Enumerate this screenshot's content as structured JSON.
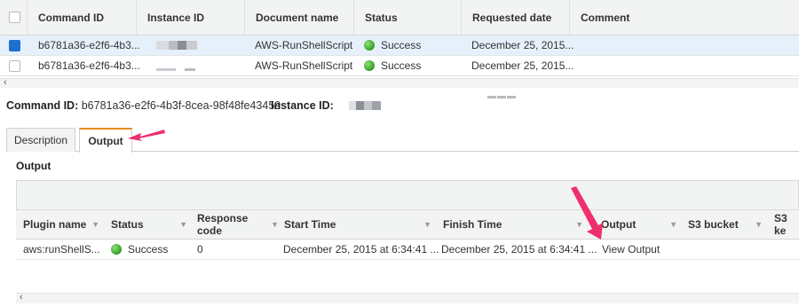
{
  "commands_table": {
    "headers": [
      "Command ID",
      "Instance ID",
      "Document name",
      "Status",
      "Requested date",
      "Comment"
    ],
    "rows": [
      {
        "command_id": "b6781a36-e2f6-4b3...",
        "document": "AWS-RunShellScript",
        "status": "Success",
        "requested": "December 25, 2015...",
        "comment": "",
        "selected": true
      },
      {
        "command_id": "b6781a36-e2f6-4b3...",
        "document": "AWS-RunShellScript",
        "status": "Success",
        "requested": "December 25, 2015...",
        "comment": "",
        "selected": false
      }
    ]
  },
  "detail": {
    "command_id_label": "Command ID:",
    "command_id_value": "b6781a36-e2f6-4b3f-8cea-98f48fe43459",
    "instance_id_label": "Instance ID:"
  },
  "tabs": [
    {
      "label": "Description",
      "active": false
    },
    {
      "label": "Output",
      "active": true
    }
  ],
  "output": {
    "title": "Output",
    "headers": [
      "Plugin name",
      "Status",
      "Response code",
      "Start Time",
      "Finish Time",
      "Output",
      "S3 bucket",
      "S3 ke"
    ],
    "row": {
      "plugin": "aws:runShellS...",
      "status": "Success",
      "response_code": "0",
      "start": "December 25, 2015 at 6:34:41 ...",
      "finish": "December 25, 2015 at 6:34:41 ...",
      "output_link": "View Output"
    }
  },
  "colors": {
    "accent_tab": "#e88b1a",
    "annotation_arrow": "#ef2f6b",
    "success": "#3aa32a",
    "link": "#1f63b8"
  },
  "icons": {
    "status": "green-dot-icon",
    "sort": "caret-down-icon",
    "scroll": "chevron-left-icon"
  }
}
